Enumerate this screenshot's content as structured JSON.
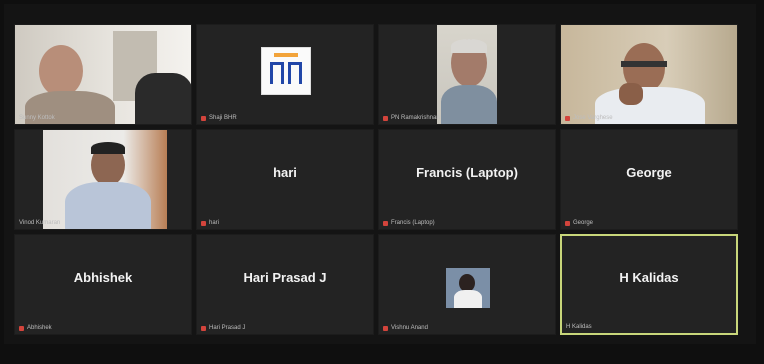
{
  "participants": [
    {
      "name": "",
      "footer": "Sunny Kottok",
      "type": "video",
      "mic_muted": true
    },
    {
      "name": "",
      "footer": "Shaji BHR",
      "type": "logo",
      "mic_muted": true
    },
    {
      "name": "",
      "footer": "PN Ramakrishnan",
      "type": "video",
      "mic_muted": true
    },
    {
      "name": "",
      "footer": "Jose Varghese",
      "type": "video",
      "mic_muted": true
    },
    {
      "name": "",
      "footer": "Vinod Kumaran",
      "type": "video",
      "mic_muted": true
    },
    {
      "name": "hari",
      "footer": "hari",
      "type": "name",
      "mic_muted": true
    },
    {
      "name": "Francis (Laptop)",
      "footer": "Francis (Laptop)",
      "type": "name",
      "mic_muted": true
    },
    {
      "name": "George",
      "footer": "George",
      "type": "name",
      "mic_muted": true
    },
    {
      "name": "Abhishek",
      "footer": "Abhishek",
      "type": "name",
      "mic_muted": true
    },
    {
      "name": "Hari Prasad J",
      "footer": "Hari Prasad J",
      "type": "name",
      "mic_muted": true
    },
    {
      "name": "",
      "footer": "Vishnu Anand",
      "type": "avatar",
      "mic_muted": true
    },
    {
      "name": "H Kalidas",
      "footer": "H Kalidas",
      "type": "name",
      "mic_muted": false,
      "active_speaker": true
    }
  ],
  "colors": {
    "active_border": "#c8d67a",
    "tile_bg": "#232323",
    "muted_mic": "#d3443c"
  }
}
